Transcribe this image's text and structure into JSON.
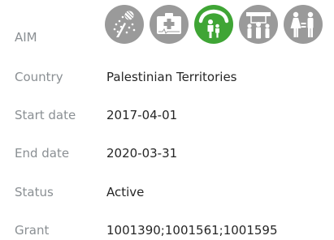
{
  "rows": [
    {
      "label": "AIM"
    },
    {
      "label": "Country",
      "value": "Palestinian Territories"
    },
    {
      "label": "Start date",
      "value": "2017-04-01"
    },
    {
      "label": "End date",
      "value": "2020-03-31"
    },
    {
      "label": "Status",
      "value": "Active"
    },
    {
      "label": "Grant",
      "value": "1001390;1001561;1001595"
    }
  ],
  "aim_icons": [
    {
      "name": "agriculture-icon",
      "color": "#9a9a9a",
      "active": false
    },
    {
      "name": "health-icon",
      "color": "#9a9a9a",
      "active": false
    },
    {
      "name": "protection-icon",
      "color": "#3fa535",
      "active": true
    },
    {
      "name": "community-icon",
      "color": "#9a9a9a",
      "active": false
    },
    {
      "name": "gender-icon",
      "color": "#9a9a9a",
      "active": false
    }
  ]
}
